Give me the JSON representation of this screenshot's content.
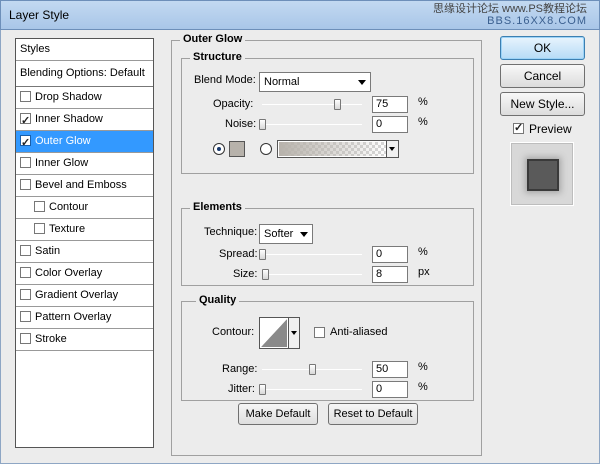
{
  "window": {
    "title": "Layer Style",
    "watermark_line1": "思缘设计论坛 www.PS教程论坛",
    "watermark_line2": "BBS.16XX8.COM"
  },
  "styles_list": {
    "header": "Styles",
    "blending": "Blending Options: Default",
    "items": [
      {
        "label": "Drop Shadow",
        "checked": false
      },
      {
        "label": "Inner Shadow",
        "checked": true
      },
      {
        "label": "Outer Glow",
        "checked": true,
        "selected": true
      },
      {
        "label": "Inner Glow",
        "checked": false
      },
      {
        "label": "Bevel and Emboss",
        "checked": false
      },
      {
        "label": "Contour",
        "checked": false,
        "sub": true
      },
      {
        "label": "Texture",
        "checked": false,
        "sub": true
      },
      {
        "label": "Satin",
        "checked": false
      },
      {
        "label": "Color Overlay",
        "checked": false
      },
      {
        "label": "Gradient Overlay",
        "checked": false
      },
      {
        "label": "Pattern Overlay",
        "checked": false
      },
      {
        "label": "Stroke",
        "checked": false
      }
    ]
  },
  "outer_glow": {
    "title": "Outer Glow",
    "structure": {
      "title": "Structure",
      "blend_mode_label": "Blend Mode:",
      "blend_mode_value": "Normal",
      "opacity_label": "Opacity:",
      "opacity_value": "75",
      "opacity_level": 0.75,
      "noise_label": "Noise:",
      "noise_value": "0",
      "noise_level": 0,
      "unit": "%",
      "glow_color": "#b7b2ab"
    },
    "elements": {
      "title": "Elements",
      "technique_label": "Technique:",
      "technique_value": "Softer",
      "spread_label": "Spread:",
      "spread_value": "0",
      "spread_level": 0,
      "spread_unit": "%",
      "size_label": "Size:",
      "size_value": "8",
      "size_level": 0.03,
      "size_unit": "px"
    },
    "quality": {
      "title": "Quality",
      "contour_label": "Contour:",
      "anti_aliased_label": "Anti-aliased",
      "range_label": "Range:",
      "range_value": "50",
      "range_level": 0.5,
      "range_unit": "%",
      "jitter_label": "Jitter:",
      "jitter_value": "0",
      "jitter_level": 0,
      "jitter_unit": "%"
    },
    "make_default": "Make Default",
    "reset_default": "Reset to Default"
  },
  "actions": {
    "ok": "OK",
    "cancel": "Cancel",
    "new_style": "New Style...",
    "preview_label": "Preview"
  }
}
